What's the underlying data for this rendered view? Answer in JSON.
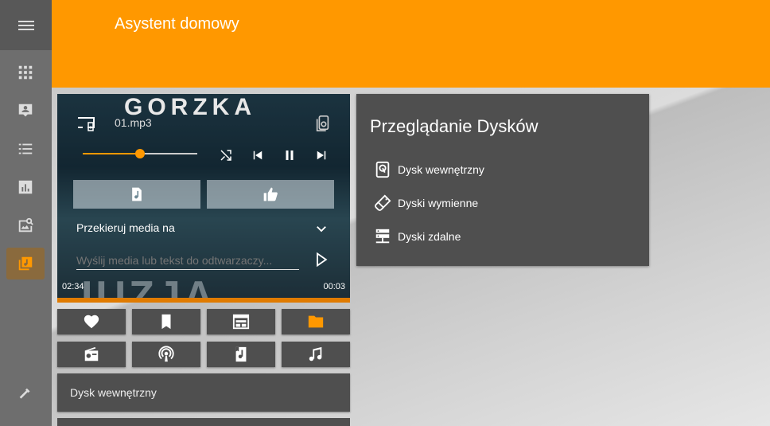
{
  "header": {
    "title": "Asystent domowy"
  },
  "sidebar": {
    "items": [
      {
        "name": "apps-icon"
      },
      {
        "name": "person-card-icon"
      },
      {
        "name": "list-icon"
      },
      {
        "name": "chart-icon"
      },
      {
        "name": "image-search-icon"
      },
      {
        "name": "music-library-icon",
        "active": true
      },
      {
        "name": "hammer-icon"
      }
    ]
  },
  "player": {
    "album_title": "GORZKA",
    "album_bottom": "IUZJA",
    "file_name": "01.mp3",
    "progress": 0.5,
    "redirect_label": "Przekieruj media na",
    "send_placeholder": "Wyślij media lub tekst do odtwarzaczy...",
    "time_elapsed": "02:34",
    "time_total": "00:03"
  },
  "drive_bar": {
    "label": "Dysk wewnętrzny"
  },
  "disk_panel": {
    "title": "Przeglądanie Dysków",
    "items": [
      {
        "label": "Dysk wewnętrzny",
        "icon": "hdd-icon"
      },
      {
        "label": "Dyski wymienne",
        "icon": "usb-icon"
      },
      {
        "label": "Dyski zdalne",
        "icon": "server-icon"
      }
    ]
  },
  "colors": {
    "accent": "#ff9800",
    "panel": "#4f4f4f",
    "sidebar": "#6e6e6e"
  }
}
